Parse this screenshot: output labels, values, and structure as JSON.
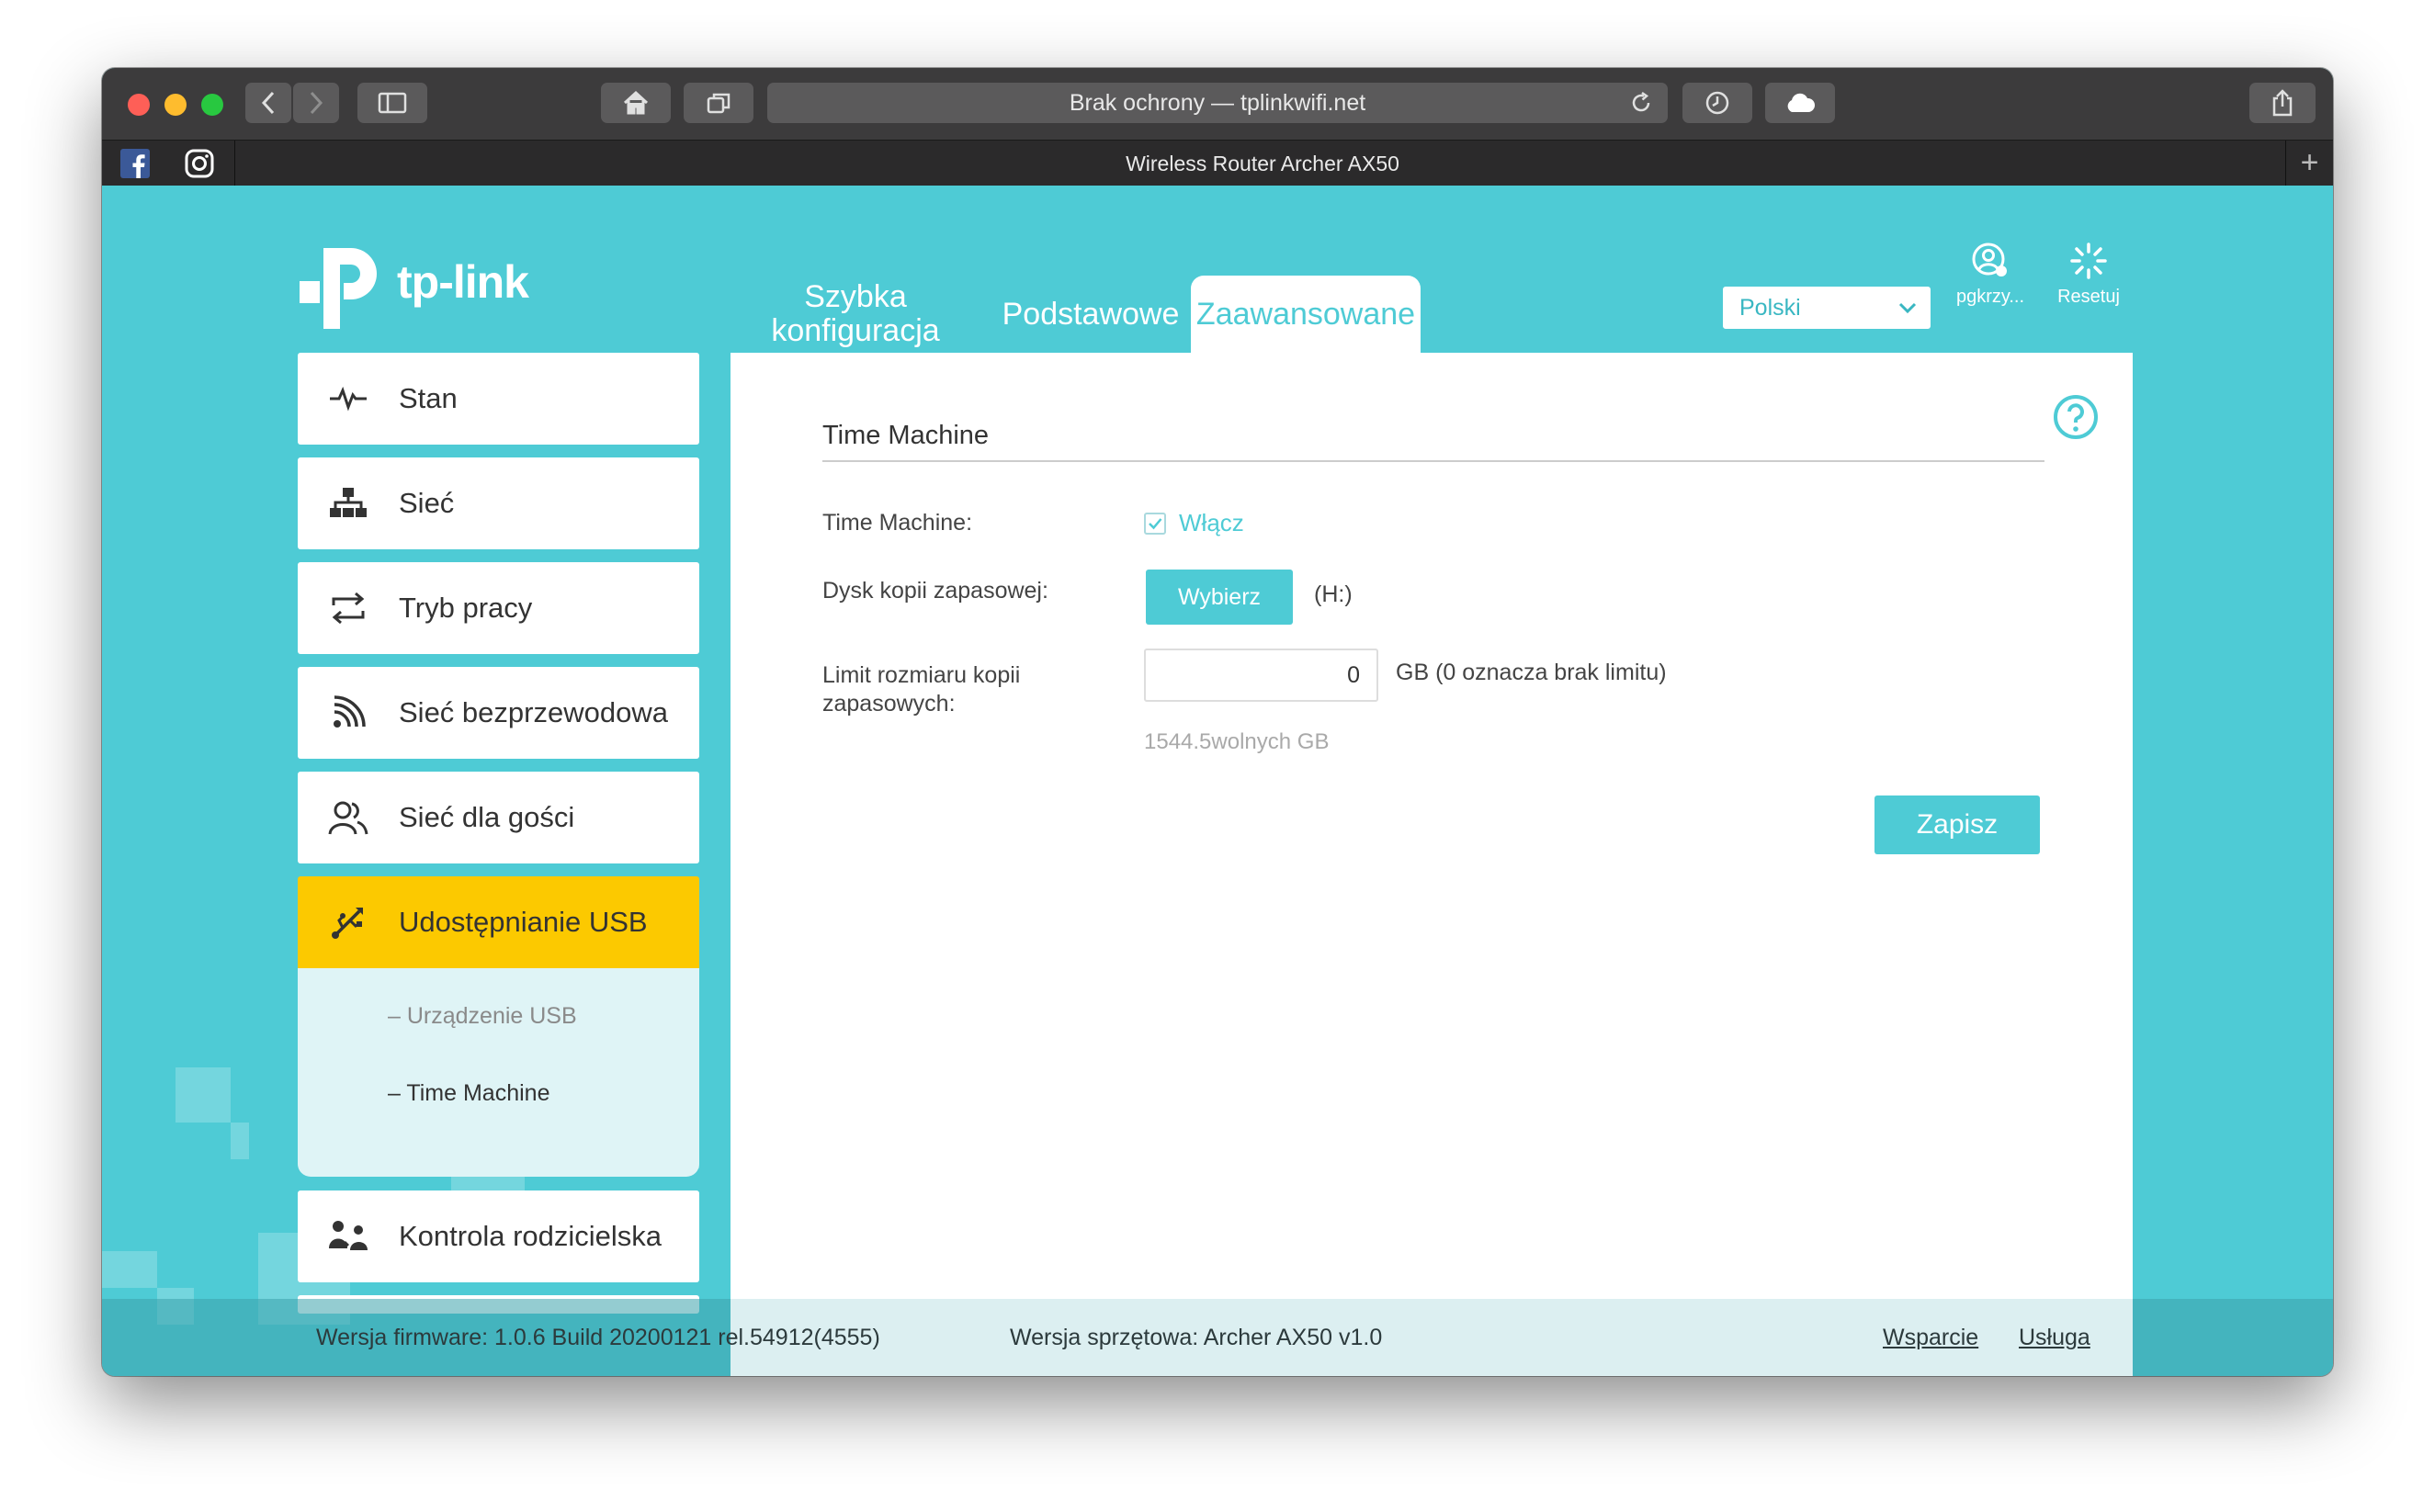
{
  "browser": {
    "url_text": "Brak ochrony — tplinkwifi.net",
    "tab_title": "Wireless Router Archer AX50",
    "traffic_light_colors": [
      "#fe5f57",
      "#febc2e",
      "#28c840"
    ]
  },
  "header": {
    "logo_text": "tp-link",
    "nav_tabs": [
      {
        "line1": "Szybka",
        "line2": "konfiguracja"
      },
      {
        "label": "Podstawowe"
      },
      {
        "label": "Zaawansowane",
        "active": true
      }
    ],
    "language": "Polski",
    "user_label": "pgkrzy...",
    "reset_label": "Resetuj"
  },
  "sidebar": {
    "items": [
      {
        "label": "Stan",
        "icon": "pulse-icon"
      },
      {
        "label": "Sieć",
        "icon": "network-icon"
      },
      {
        "label": "Tryb pracy",
        "icon": "swap-icon"
      },
      {
        "label": "Sieć bezprzewodowa",
        "icon": "wifi-icon"
      },
      {
        "label": "Sieć dla gości",
        "icon": "guests-icon"
      },
      {
        "label": "Udostępnianie USB",
        "icon": "usb-icon",
        "active": true
      },
      {
        "label": "Kontrola rodzicielska",
        "icon": "family-icon"
      }
    ],
    "subitems": [
      {
        "label": "Urządzenie USB",
        "prefix": "–"
      },
      {
        "label": "Time Machine",
        "prefix": "–",
        "current": true
      }
    ]
  },
  "content": {
    "section_title": "Time Machine",
    "time_machine_label": "Time Machine:",
    "enable_label": "Włącz",
    "enable_checked": true,
    "backup_disk_label": "Dysk kopii zapasowej:",
    "select_button": "Wybierz",
    "drive_value": "(H:)",
    "limit_label_line1": "Limit rozmiaru kopii",
    "limit_label_line2": "zapasowych:",
    "limit_value": "0",
    "limit_unit": "GB (0 oznacza brak limitu)",
    "free_space": "1544.5wolnych GB",
    "save_button": "Zapisz"
  },
  "footer": {
    "firmware": "Wersja firmware: 1.0.6 Build 20200121 rel.54912(4555)",
    "hardware": "Wersja sprzętowa: Archer AX50 v1.0",
    "support_link": "Wsparcie",
    "service_link": "Usługa"
  },
  "colors": {
    "brand": "#4ecbd5",
    "active_menu": "#fcc900",
    "submenu_bg": "#dff4f6"
  }
}
